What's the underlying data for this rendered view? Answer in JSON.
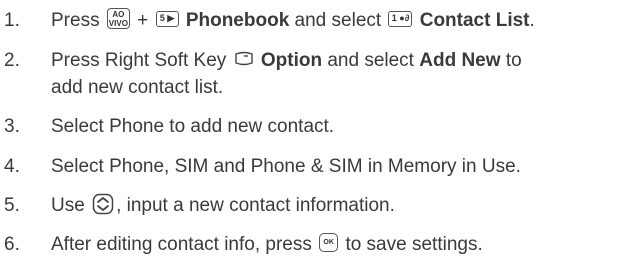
{
  "steps": [
    {
      "num": "1.",
      "press": "Press",
      "key_aovivo_top": "AO",
      "key_aovivo_bottom": "VIVO",
      "plus": "+",
      "key_5": "5 ▶",
      "phonebook": "Phonebook",
      "and_select": "and select",
      "key_1": "1 ●∂",
      "contact_list": "Contact List",
      "end": "."
    },
    {
      "num": "2.",
      "line1_pre": "Press Right Soft Key",
      "option": "Option",
      "and_select": "and select",
      "add_new": "Add New",
      "to": "to",
      "line2": "add new contact list."
    },
    {
      "num": "3.",
      "text": "Select Phone to add new contact."
    },
    {
      "num": "4.",
      "text": "Select Phone, SIM and Phone & SIM in Memory in Use."
    },
    {
      "num": "5.",
      "pre": "Use",
      "post": ", input a new contact information."
    },
    {
      "num": "6.",
      "pre": "After editing contact info, press",
      "key_ok": "OK",
      "post": "to save settings."
    }
  ],
  "icons": {
    "soft_key": "right-soft-key-icon",
    "nav": "navigation-key-icon",
    "ok": "ok-key-icon"
  }
}
